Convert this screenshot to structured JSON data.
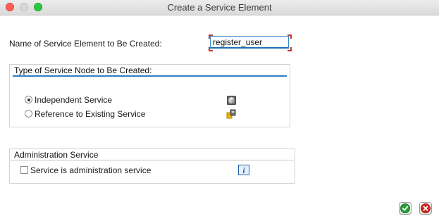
{
  "window": {
    "title": "Create a Service Element"
  },
  "form": {
    "name_label": "Name of Service Element to Be Created:",
    "name_value": "register_user"
  },
  "type_group": {
    "title": "Type of Service Node to Be Created:",
    "options": [
      {
        "label": "Independent Service",
        "selected": true,
        "icon": "service-cube-icon"
      },
      {
        "label": "Reference to Existing Service",
        "selected": false,
        "icon": "service-reference-icon"
      }
    ]
  },
  "admin_group": {
    "title": "Administration Service",
    "checkbox_label": "Service is administration service",
    "checked": false,
    "info_glyph": "i"
  },
  "footer": {
    "confirm_icon": "confirm-check-icon",
    "cancel_icon": "cancel-x-icon"
  },
  "colors": {
    "accent": "#2f7fc6",
    "confirm": "#2a9d3a",
    "cancel": "#d0281f"
  }
}
